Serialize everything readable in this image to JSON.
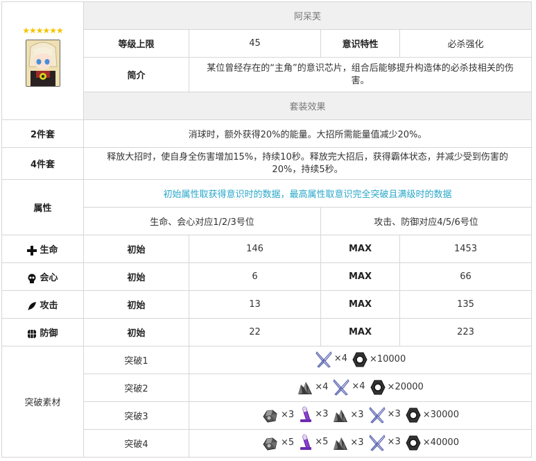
{
  "header": {
    "stars": "★★★★★★",
    "name": "阿呆芙",
    "level_cap_label": "等级上限",
    "level_cap_value": "45",
    "trait_label": "意识特性",
    "trait_value": "必杀强化",
    "intro_label": "简介",
    "intro_text": "某位曾经存在的“主角”的意识芯片，组合后能够提升构造体的必杀技相关的伤害。"
  },
  "set_effect": {
    "title": "套装效果",
    "two_piece_label": "2件套",
    "two_piece_text": "消球时，额外获得20%的能量。大招所需能量值减少20%。",
    "four_piece_label": "4件套",
    "four_piece_text": "释放大招时，使自身全伤害增加15%，持续10秒。释放完大招后，获得霸体状态，并减少受到伤害的20%，持续5秒。"
  },
  "attributes": {
    "label": "属性",
    "note": "初始属性取获得意识时的数据，最高属性取意识完全突破且满级时的数据",
    "left_positions": "生命、会心对应1/2/3号位",
    "right_positions": "攻击、防御对应4/5/6号位",
    "init_label": "初始",
    "max_label": "MAX",
    "rows": [
      {
        "name": "生命",
        "icon": "plus-icon",
        "init": "146",
        "max": "1453"
      },
      {
        "name": "会心",
        "icon": "skull-icon",
        "init": "6",
        "max": "66"
      },
      {
        "name": "攻击",
        "icon": "feather-icon",
        "init": "13",
        "max": "135"
      },
      {
        "name": "防御",
        "icon": "shield-block-icon",
        "init": "22",
        "max": "223"
      }
    ]
  },
  "breakthrough": {
    "label": "突破素材",
    "stages": [
      {
        "name": "突破1",
        "materials": [
          {
            "icon": "tweezers-icon",
            "qty": "×4"
          },
          {
            "icon": "hex-nut-icon",
            "qty": "×10000"
          }
        ]
      },
      {
        "name": "突破2",
        "materials": [
          {
            "icon": "ore-icon",
            "qty": "×4"
          },
          {
            "icon": "tweezers-icon",
            "qty": "×4"
          },
          {
            "icon": "hex-nut-icon",
            "qty": "×20000"
          }
        ]
      },
      {
        "name": "突破3",
        "materials": [
          {
            "icon": "gear-cluster-icon",
            "qty": "×3"
          },
          {
            "icon": "vial-icon",
            "qty": "×3"
          },
          {
            "icon": "ore-icon",
            "qty": "×3"
          },
          {
            "icon": "tweezers-icon",
            "qty": "×3"
          },
          {
            "icon": "hex-nut-icon",
            "qty": "×30000"
          }
        ]
      },
      {
        "name": "突破4",
        "materials": [
          {
            "icon": "gear-cluster-icon",
            "qty": "×5"
          },
          {
            "icon": "vial-icon",
            "qty": "×5"
          },
          {
            "icon": "ore-icon",
            "qty": "×3"
          },
          {
            "icon": "tweezers-icon",
            "qty": "×3"
          },
          {
            "icon": "hex-nut-icon",
            "qty": "×40000"
          }
        ]
      }
    ]
  }
}
